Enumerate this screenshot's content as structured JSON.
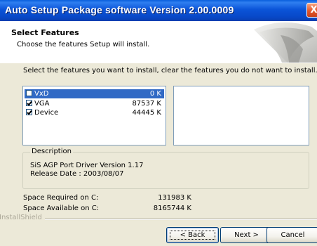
{
  "window": {
    "title": "Auto Setup Package software Version 2.00.0009",
    "close_glyph": "X"
  },
  "header": {
    "title": "Select Features",
    "subtitle": "Choose the features Setup will install."
  },
  "instruction": "Select the features you want to install, clear the features you do not want to install.",
  "features": [
    {
      "name": "VxD",
      "size": "0 K",
      "checked": false,
      "selected": true
    },
    {
      "name": "VGA",
      "size": "87537 K",
      "checked": true,
      "selected": false
    },
    {
      "name": "Device",
      "size": "44445 K",
      "checked": true,
      "selected": false
    }
  ],
  "description": {
    "legend": "Description",
    "line1": "SiS AGP Port Driver Version 1.17",
    "line2": "Release Date : 2003/08/07"
  },
  "space": {
    "required_label": "Space Required on  C:",
    "required_value": "131983 K",
    "available_label": "Space Available on  C:",
    "available_value": "8165744 K"
  },
  "brand": "InstallShield",
  "buttons": {
    "back": "< Back",
    "next": "Next >",
    "cancel": "Cancel"
  },
  "colors": {
    "title_bar": "#0b54d8",
    "selection": "#316ac5",
    "dialog_face": "#ece9d8"
  }
}
